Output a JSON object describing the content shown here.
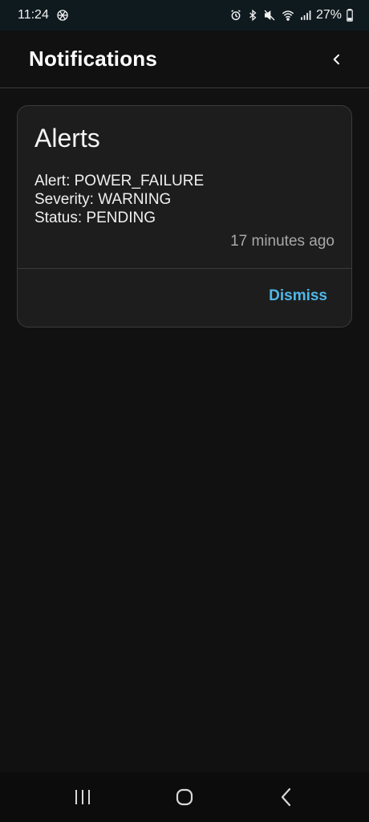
{
  "status_bar": {
    "time": "11:24",
    "battery": "27%",
    "icons": [
      "chatgpt-icon",
      "alarm-icon",
      "bluetooth-icon",
      "mute-icon",
      "wifi-icon",
      "signal-icon",
      "battery-icon"
    ]
  },
  "header": {
    "title": "Notifications",
    "back_icon": "chevron-left-icon"
  },
  "card": {
    "title": "Alerts",
    "lines": [
      "Alert: POWER_FAILURE",
      "Severity: WARNING",
      "Status: PENDING"
    ],
    "time_ago": "17 minutes ago",
    "dismiss_label": "Dismiss"
  },
  "nav_bar": {
    "icons": [
      "recent-apps-icon",
      "home-icon",
      "back-icon"
    ]
  },
  "colors": {
    "background": "#111111",
    "card": "#1d1d1d",
    "accent": "#4fb7e8",
    "muted_text": "#a8a8a8"
  }
}
